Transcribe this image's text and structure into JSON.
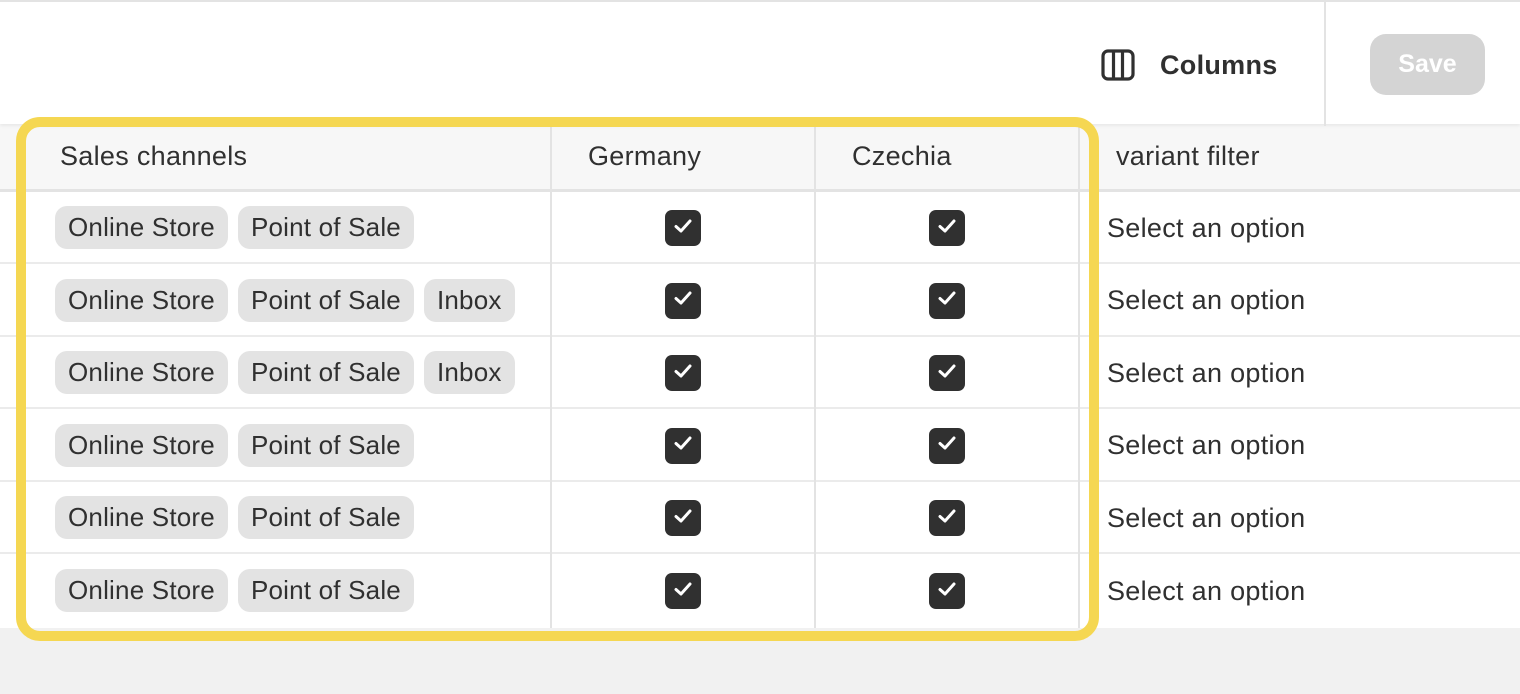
{
  "toolbar": {
    "columns_label": "Columns",
    "columns_icon": "columns-icon",
    "save_label": "Save"
  },
  "table": {
    "headers": {
      "sales_channels": "Sales channels",
      "germany": "Germany",
      "czechia": "Czechia",
      "variant_filter": "variant filter"
    },
    "rows": [
      {
        "channels": [
          "Online Store",
          "Point of Sale"
        ],
        "germany": true,
        "czechia": true,
        "variant_filter": "Select an option"
      },
      {
        "channels": [
          "Online Store",
          "Point of Sale",
          "Inbox"
        ],
        "germany": true,
        "czechia": true,
        "variant_filter": "Select an option"
      },
      {
        "channels": [
          "Online Store",
          "Point of Sale",
          "Inbox"
        ],
        "germany": true,
        "czechia": true,
        "variant_filter": "Select an option"
      },
      {
        "channels": [
          "Online Store",
          "Point of Sale"
        ],
        "germany": true,
        "czechia": true,
        "variant_filter": "Select an option"
      },
      {
        "channels": [
          "Online Store",
          "Point of Sale"
        ],
        "germany": true,
        "czechia": true,
        "variant_filter": "Select an option"
      },
      {
        "channels": [
          "Online Store",
          "Point of Sale"
        ],
        "germany": true,
        "czechia": true,
        "variant_filter": "Select an option"
      }
    ]
  },
  "colors": {
    "highlight": "#f5d752",
    "checkbox": "#303030",
    "chip_bg": "#e3e3e3",
    "save_disabled": "#d4d4d4"
  }
}
